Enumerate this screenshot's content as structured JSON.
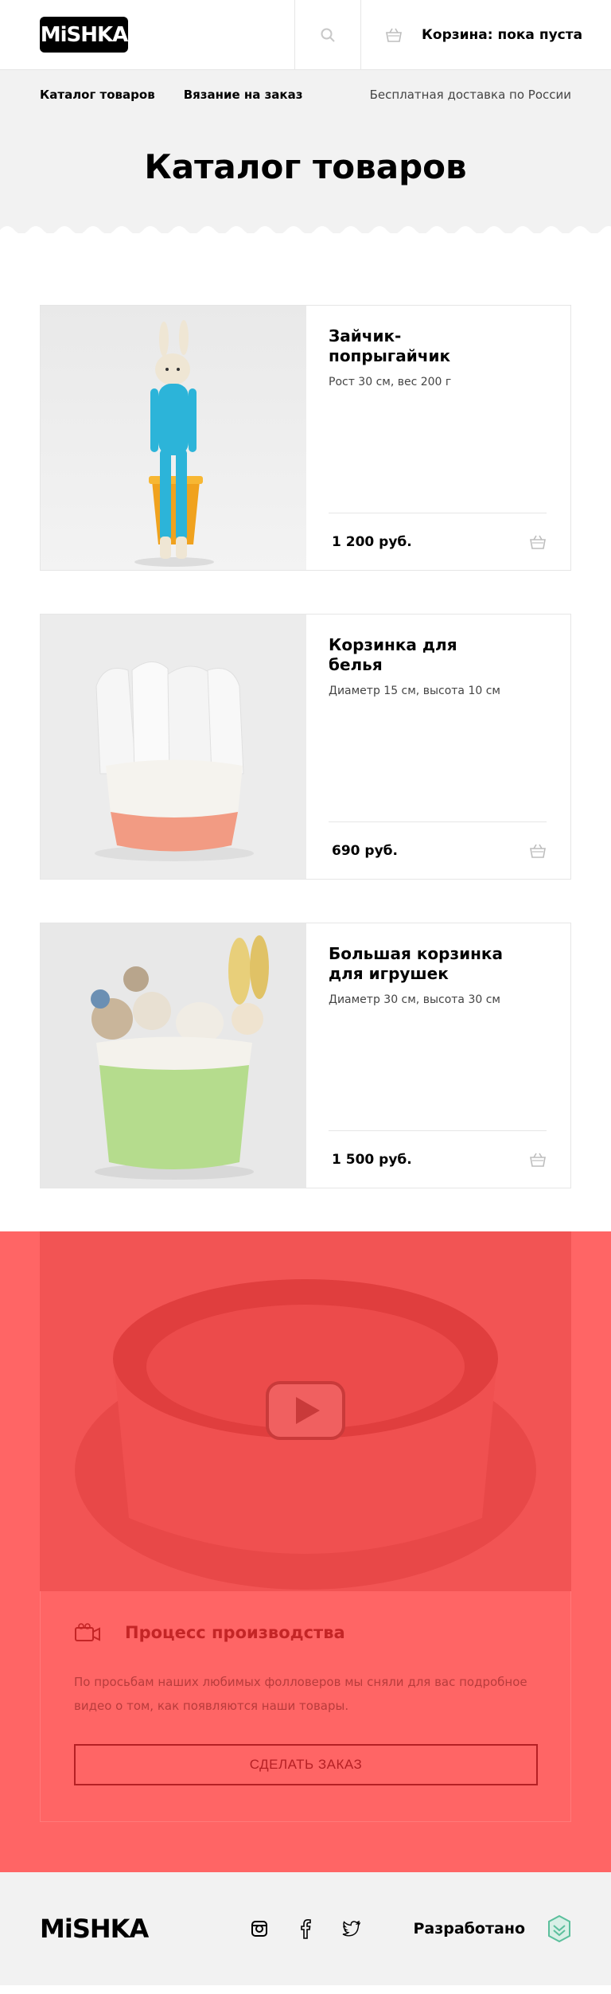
{
  "header": {
    "logo_text": "MiSHKA",
    "cart_label": "Корзина: пока пуста"
  },
  "nav": {
    "catalog": "Каталог товаров",
    "knitting": "Вязание на заказ",
    "delivery": "Бесплатная доставка по России"
  },
  "page_title": "Каталог товаров",
  "products": [
    {
      "title": "Зайчик-попрыгайчик",
      "desc": "Рост 30 см, вес 200 г",
      "price": "1 200 руб.",
      "image": "blue-bunny-toy"
    },
    {
      "title": "Корзинка для белья",
      "desc": "Диаметр 15 см, высота 10 см",
      "price": "690 руб.",
      "image": "laundry-basket"
    },
    {
      "title": "Большая корзинка для игрушек",
      "desc": "Диаметр 30 см, высота 30 см",
      "price": "1 500 руб.",
      "image": "toy-basket"
    }
  ],
  "video": {
    "title": "Процесс производства",
    "text": "По просьбам наших любимых фолловеров мы сняли для вас подробное видео о том, как появляются наши товары.",
    "button": "СДЕЛАТЬ ЗАКАЗ"
  },
  "footer": {
    "logo_text": "MiSHKA",
    "developed_label": "Разработано"
  },
  "colors": {
    "accent": "#ff6565",
    "accent_dark": "#c42526",
    "band_bg": "#f2f2f2"
  }
}
